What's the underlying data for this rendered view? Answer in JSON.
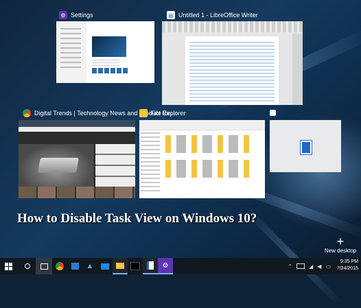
{
  "windows": {
    "settings": {
      "title": "Settings",
      "icon": "gear-icon",
      "accent": "#5e35b1"
    },
    "writer": {
      "title": "Untitled 1 - LibreOffice Writer",
      "icon": "writer-icon"
    },
    "browser": {
      "title": "Digital Trends | Technology News and Product Re...",
      "icon": "chrome-icon"
    },
    "explorer": {
      "title": "File Explorer",
      "icon": "folder-icon"
    },
    "extra": {
      "icon": "window-icon"
    }
  },
  "headline": "How to Disable Task View on Windows 10?",
  "new_desktop": {
    "label": "New desktop",
    "icon": "plus-icon"
  },
  "taskbar": {
    "start_icon": "windows-logo-icon",
    "search_icon": "search-icon",
    "taskview_icon": "task-view-icon",
    "apps": [
      "chrome-icon",
      "store-icon",
      "twitter-icon",
      "photos-icon",
      "file-explorer-icon",
      "terminal-icon",
      "writer-icon",
      "settings-icon"
    ],
    "tray": [
      "chevron-up-icon",
      "battery-icon",
      "network-icon",
      "volume-icon",
      "notification-icon"
    ],
    "time": "9:35 PM",
    "date": "7/24/2015"
  },
  "colors": {
    "accent": "#1f6bc4",
    "taskbar": "#101820"
  }
}
